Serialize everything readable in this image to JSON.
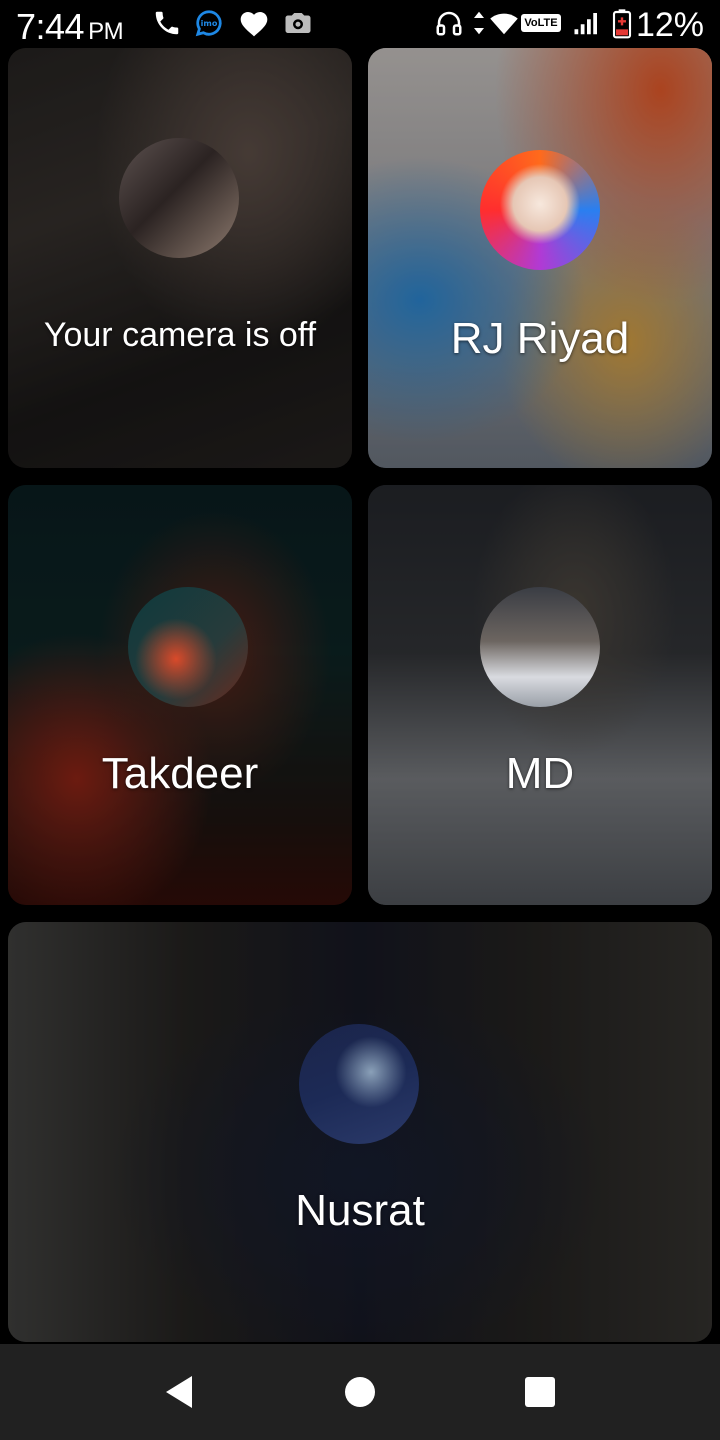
{
  "status_bar": {
    "time": "7:44",
    "ampm": "PM",
    "network_badge": "VoLTE",
    "battery": "12%",
    "icons": [
      "phone-icon",
      "imo-icon",
      "heart-icon",
      "camera-icon",
      "headphones-icon",
      "data-arrows-icon",
      "wifi-icon",
      "signal-icon",
      "battery-icon"
    ]
  },
  "participants": [
    {
      "label": "Your camera is off"
    },
    {
      "label": "RJ Riyad"
    },
    {
      "label": "Takdeer"
    },
    {
      "label": "MD"
    },
    {
      "label": "Nusrat"
    }
  ],
  "nav_bar": {
    "icons": [
      "back-icon",
      "home-icon",
      "recents-icon"
    ]
  }
}
